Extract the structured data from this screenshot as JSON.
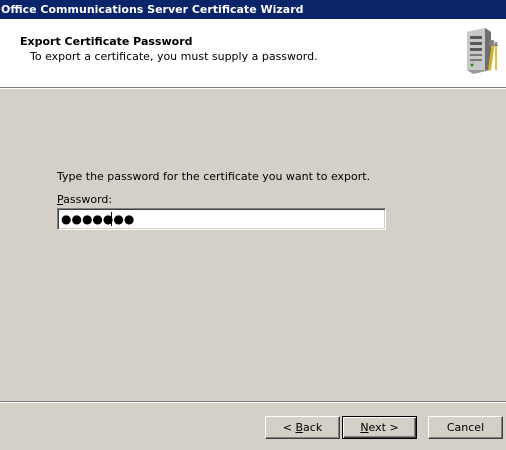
{
  "window": {
    "title": "Office Communications Server Certificate Wizard"
  },
  "header": {
    "title": "Export Certificate Password",
    "subtitle": "To export a certificate, you must supply a password.",
    "icon": "server-tools-icon"
  },
  "body": {
    "prompt": "Type the password for the certificate you want to export.",
    "password_label_accel": "P",
    "password_label_rest": "assword:",
    "password_masked": "●●●●●●●"
  },
  "footer": {
    "back_prefix": "< ",
    "back_accel": "B",
    "back_rest": "ack",
    "next_accel": "N",
    "next_rest": "ext >",
    "cancel_label": "Cancel"
  },
  "colors": {
    "titlebar": "#0a246a",
    "dialog_bg": "#d4d0c8",
    "header_bg": "#ffffff"
  }
}
